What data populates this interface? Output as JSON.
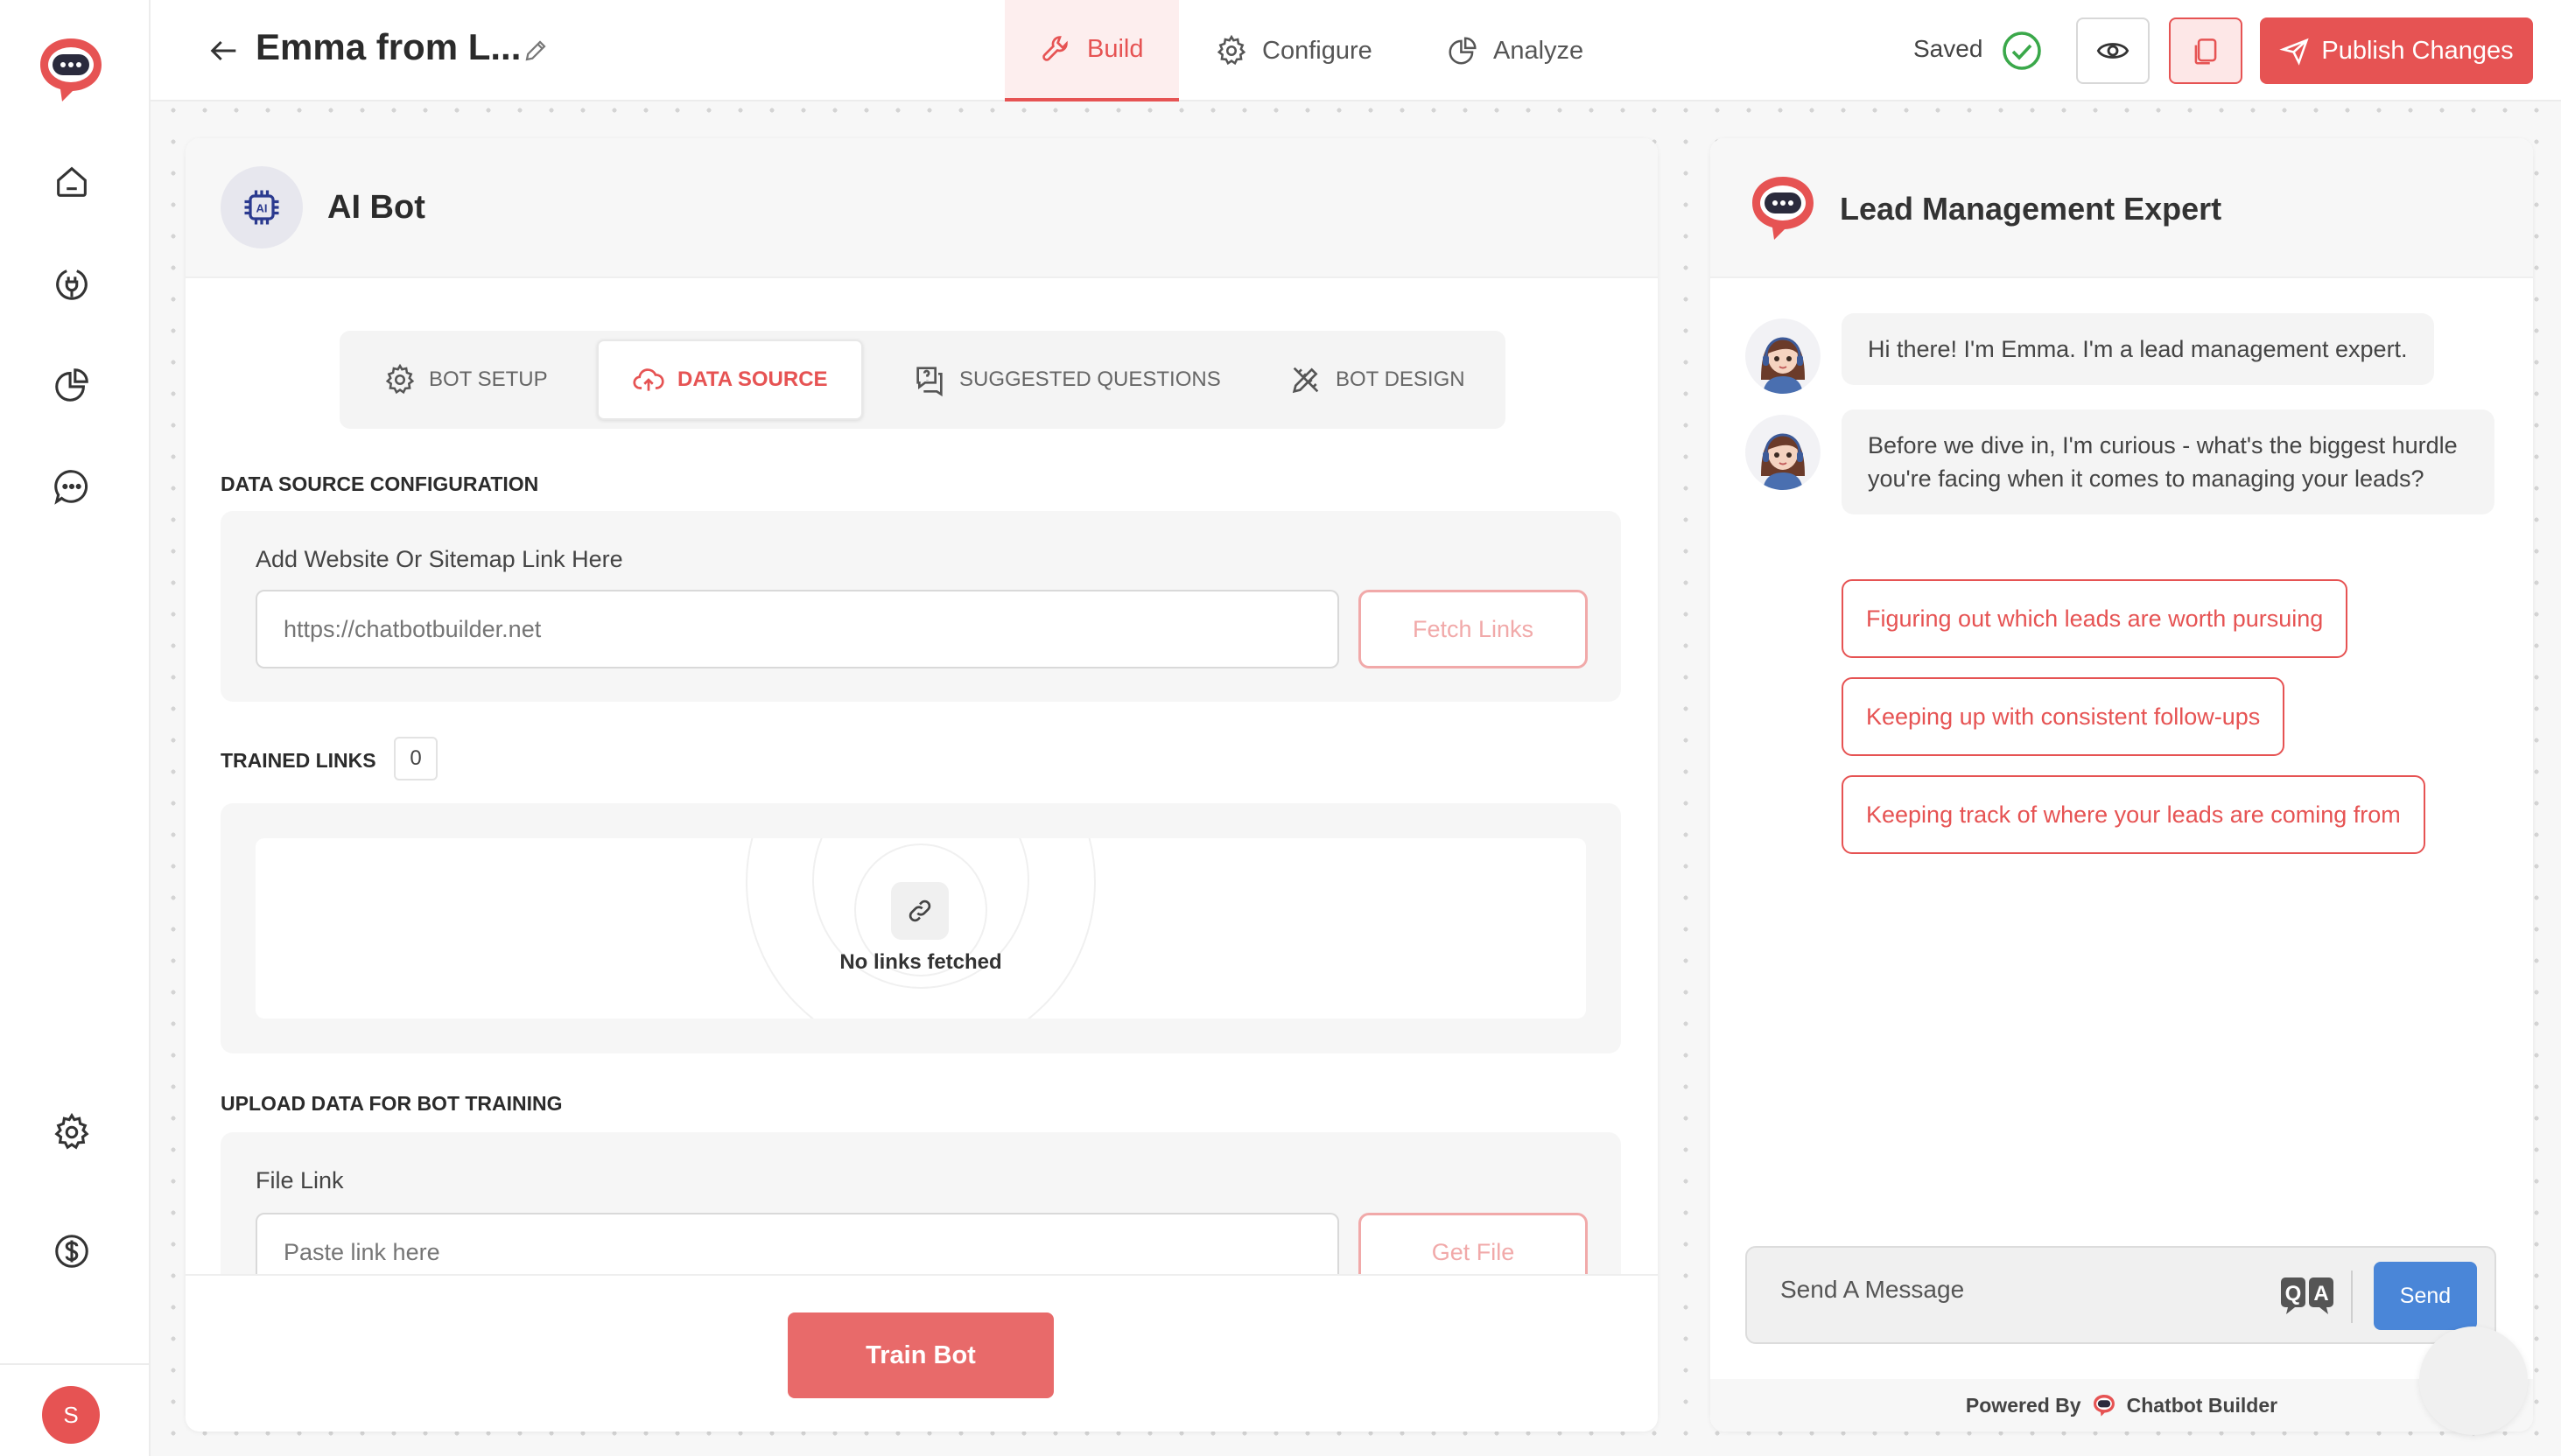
{
  "header": {
    "bot_name": "Emma from L...",
    "tabs": [
      {
        "label": "Build",
        "icon": "wrench-icon",
        "active": true
      },
      {
        "label": "Configure",
        "icon": "gear-icon",
        "active": false
      },
      {
        "label": "Analyze",
        "icon": "pie-chart-icon",
        "active": false
      }
    ],
    "saved_label": "Saved",
    "publish_label": "Publish Changes"
  },
  "sidebar": {
    "items": [
      {
        "name": "home",
        "icon": "home-icon"
      },
      {
        "name": "integrations",
        "icon": "plug-icon"
      },
      {
        "name": "analytics",
        "icon": "pie-chart-icon"
      },
      {
        "name": "chats",
        "icon": "chat-icon"
      },
      {
        "name": "settings",
        "icon": "gear-icon"
      },
      {
        "name": "billing",
        "icon": "dollar-icon"
      }
    ],
    "avatar_initial": "S"
  },
  "builder": {
    "title": "AI Bot",
    "subtabs": [
      {
        "label": "BOT SETUP",
        "icon": "gear-icon"
      },
      {
        "label": "DATA SOURCE",
        "icon": "cloud-upload-icon",
        "active": true
      },
      {
        "label": "SUGGESTED QUESTIONS",
        "icon": "question-chat-icon"
      },
      {
        "label": "BOT DESIGN",
        "icon": "pencil-ruler-icon"
      }
    ],
    "data_source_heading": "DATA SOURCE CONFIGURATION",
    "website_label": "Add Website Or Sitemap Link Here",
    "website_placeholder": "https://chatbotbuilder.net",
    "fetch_label": "Fetch Links",
    "trained_links_heading": "TRAINED LINKS",
    "trained_links_count": "0",
    "no_links_text": "No links fetched",
    "upload_heading": "UPLOAD DATA FOR BOT TRAINING",
    "file_link_label": "File Link",
    "file_link_placeholder": "Paste link here",
    "get_file_label": "Get File",
    "train_label": "Train Bot"
  },
  "chat": {
    "title": "Lead Management Expert",
    "messages": [
      "Hi there! I'm Emma. I'm a lead management expert.",
      "Before we dive in, I'm curious - what's the biggest hurdle you're facing when it comes to managing your leads?"
    ],
    "quick_replies": [
      "Figuring out which leads are worth pursuing",
      "Keeping up with consistent follow-ups",
      "Keeping track of where your leads are coming from"
    ],
    "input_placeholder": "Send A Message",
    "send_label": "Send",
    "powered_by": "Powered By",
    "brand": "Chatbot Builder"
  },
  "colors": {
    "accent": "#e65353",
    "send": "#4a86d8"
  }
}
